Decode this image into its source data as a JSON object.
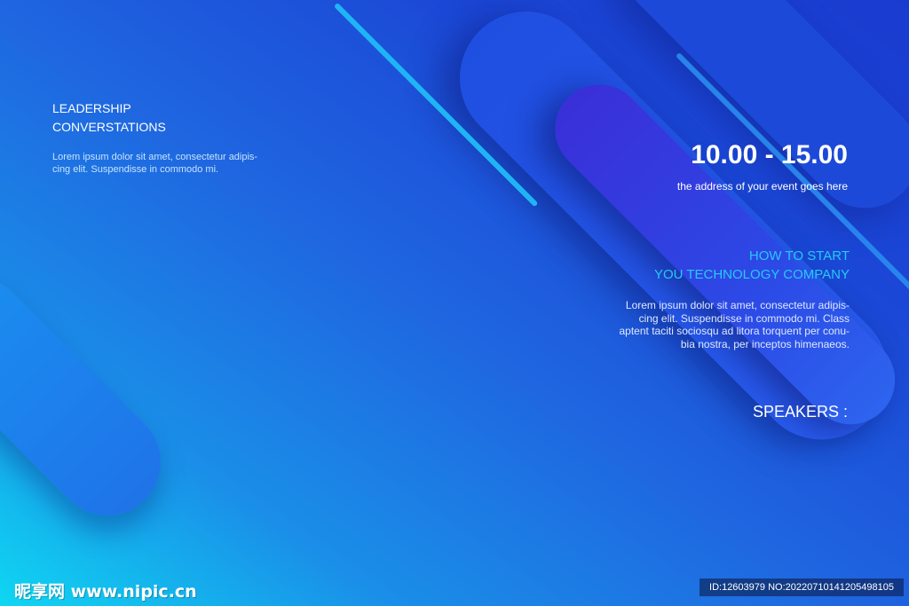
{
  "left_block": {
    "title_line1": "LEADERSHIP",
    "title_line2": "CONVERSTATIONS",
    "body_line1": "Lorem ipsum dolor sit amet, consectetur adipis-",
    "body_line2": "cing elit. Suspendisse in commodo mi."
  },
  "right_block": {
    "time": "10.00 - 15.00",
    "address": "the address of your event goes here",
    "heading_line1": "HOW TO START",
    "heading_line2": "YOU TECHNOLOGY COMPANY",
    "body_line1": "Lorem ipsum dolor sit amet, consectetur adipis-",
    "body_line2": "cing elit. Suspendisse in commodo mi. Class",
    "body_line3": "aptent taciti sociosqu ad litora torquent per conu-",
    "body_line4": "bia nostra, per inceptos himenaeos.",
    "speakers": "SPEAKERS :"
  },
  "watermark": {
    "logo": "昵享网 www.nipic.cn",
    "id": "ID:12603979 NO:20220710141205498105"
  },
  "colors": {
    "background_start": "#0fd6f2",
    "background_end": "#1a3bcf",
    "accent_cyan": "#28c9f7",
    "violet": "#3a2fd8"
  }
}
